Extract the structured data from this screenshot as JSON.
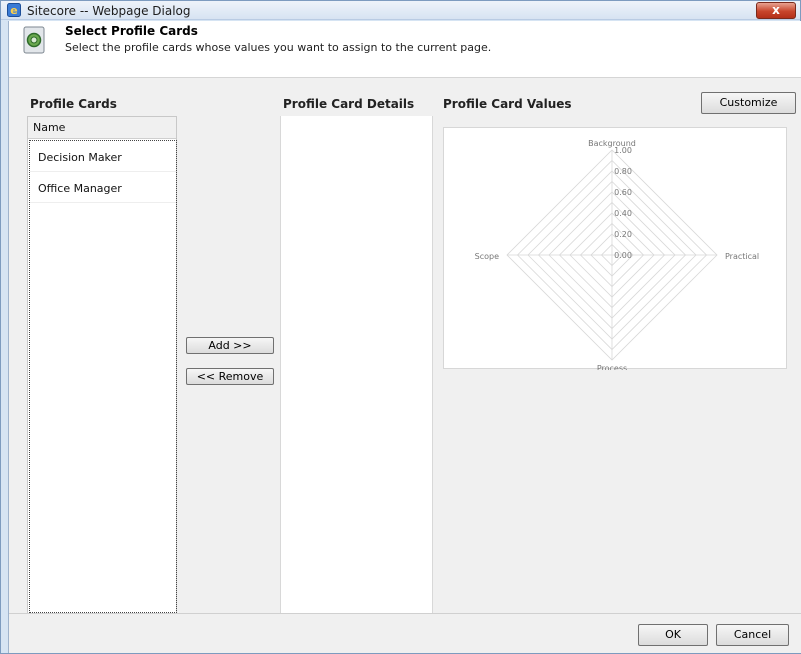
{
  "window": {
    "title": "Sitecore -- Webpage Dialog",
    "close_glyph": "x"
  },
  "header": {
    "title": "Select Profile Cards",
    "subtitle": "Select the profile cards whose values you want to assign to the current page."
  },
  "sections": {
    "profile_cards": "Profile Cards",
    "profile_card_details": "Profile Card Details",
    "profile_card_values": "Profile Card Values"
  },
  "toolbar": {
    "customize_label": "Customize"
  },
  "list": {
    "column_header": "Name",
    "items": [
      "Decision Maker",
      "Office Manager"
    ]
  },
  "actions": {
    "add_label": "Add >>",
    "remove_label": "<< Remove"
  },
  "footer": {
    "ok_label": "OK",
    "cancel_label": "Cancel"
  },
  "chart_data": {
    "type": "radar",
    "axes": [
      "Background",
      "Practical",
      "Process",
      "Scope"
    ],
    "tick_labels": [
      "0.00",
      "0.20",
      "0.40",
      "0.60",
      "0.80",
      "1.00"
    ],
    "range": [
      0,
      1
    ],
    "series": []
  },
  "colors": {
    "grid": "#d8d8d8",
    "label": "#777777"
  },
  "icons": {
    "title": "ie-icon",
    "header": "profile-cards-icon"
  }
}
